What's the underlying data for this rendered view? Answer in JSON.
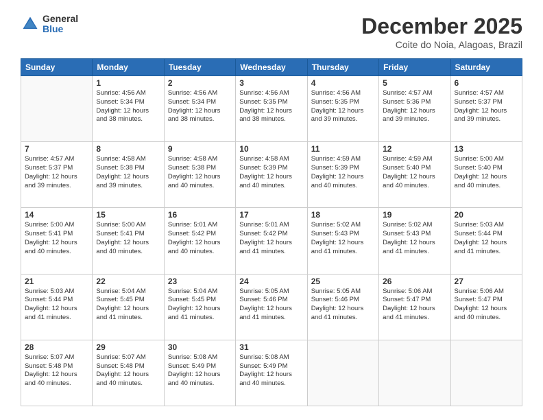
{
  "logo": {
    "general": "General",
    "blue": "Blue"
  },
  "title": "December 2025",
  "location": "Coite do Noia, Alagoas, Brazil",
  "days_of_week": [
    "Sunday",
    "Monday",
    "Tuesday",
    "Wednesday",
    "Thursday",
    "Friday",
    "Saturday"
  ],
  "weeks": [
    [
      {
        "day": "",
        "info": ""
      },
      {
        "day": "1",
        "info": "Sunrise: 4:56 AM\nSunset: 5:34 PM\nDaylight: 12 hours\nand 38 minutes."
      },
      {
        "day": "2",
        "info": "Sunrise: 4:56 AM\nSunset: 5:34 PM\nDaylight: 12 hours\nand 38 minutes."
      },
      {
        "day": "3",
        "info": "Sunrise: 4:56 AM\nSunset: 5:35 PM\nDaylight: 12 hours\nand 38 minutes."
      },
      {
        "day": "4",
        "info": "Sunrise: 4:56 AM\nSunset: 5:35 PM\nDaylight: 12 hours\nand 39 minutes."
      },
      {
        "day": "5",
        "info": "Sunrise: 4:57 AM\nSunset: 5:36 PM\nDaylight: 12 hours\nand 39 minutes."
      },
      {
        "day": "6",
        "info": "Sunrise: 4:57 AM\nSunset: 5:37 PM\nDaylight: 12 hours\nand 39 minutes."
      }
    ],
    [
      {
        "day": "7",
        "info": "Sunrise: 4:57 AM\nSunset: 5:37 PM\nDaylight: 12 hours\nand 39 minutes."
      },
      {
        "day": "8",
        "info": "Sunrise: 4:58 AM\nSunset: 5:38 PM\nDaylight: 12 hours\nand 39 minutes."
      },
      {
        "day": "9",
        "info": "Sunrise: 4:58 AM\nSunset: 5:38 PM\nDaylight: 12 hours\nand 40 minutes."
      },
      {
        "day": "10",
        "info": "Sunrise: 4:58 AM\nSunset: 5:39 PM\nDaylight: 12 hours\nand 40 minutes."
      },
      {
        "day": "11",
        "info": "Sunrise: 4:59 AM\nSunset: 5:39 PM\nDaylight: 12 hours\nand 40 minutes."
      },
      {
        "day": "12",
        "info": "Sunrise: 4:59 AM\nSunset: 5:40 PM\nDaylight: 12 hours\nand 40 minutes."
      },
      {
        "day": "13",
        "info": "Sunrise: 5:00 AM\nSunset: 5:40 PM\nDaylight: 12 hours\nand 40 minutes."
      }
    ],
    [
      {
        "day": "14",
        "info": "Sunrise: 5:00 AM\nSunset: 5:41 PM\nDaylight: 12 hours\nand 40 minutes."
      },
      {
        "day": "15",
        "info": "Sunrise: 5:00 AM\nSunset: 5:41 PM\nDaylight: 12 hours\nand 40 minutes."
      },
      {
        "day": "16",
        "info": "Sunrise: 5:01 AM\nSunset: 5:42 PM\nDaylight: 12 hours\nand 40 minutes."
      },
      {
        "day": "17",
        "info": "Sunrise: 5:01 AM\nSunset: 5:42 PM\nDaylight: 12 hours\nand 41 minutes."
      },
      {
        "day": "18",
        "info": "Sunrise: 5:02 AM\nSunset: 5:43 PM\nDaylight: 12 hours\nand 41 minutes."
      },
      {
        "day": "19",
        "info": "Sunrise: 5:02 AM\nSunset: 5:43 PM\nDaylight: 12 hours\nand 41 minutes."
      },
      {
        "day": "20",
        "info": "Sunrise: 5:03 AM\nSunset: 5:44 PM\nDaylight: 12 hours\nand 41 minutes."
      }
    ],
    [
      {
        "day": "21",
        "info": "Sunrise: 5:03 AM\nSunset: 5:44 PM\nDaylight: 12 hours\nand 41 minutes."
      },
      {
        "day": "22",
        "info": "Sunrise: 5:04 AM\nSunset: 5:45 PM\nDaylight: 12 hours\nand 41 minutes."
      },
      {
        "day": "23",
        "info": "Sunrise: 5:04 AM\nSunset: 5:45 PM\nDaylight: 12 hours\nand 41 minutes."
      },
      {
        "day": "24",
        "info": "Sunrise: 5:05 AM\nSunset: 5:46 PM\nDaylight: 12 hours\nand 41 minutes."
      },
      {
        "day": "25",
        "info": "Sunrise: 5:05 AM\nSunset: 5:46 PM\nDaylight: 12 hours\nand 41 minutes."
      },
      {
        "day": "26",
        "info": "Sunrise: 5:06 AM\nSunset: 5:47 PM\nDaylight: 12 hours\nand 41 minutes."
      },
      {
        "day": "27",
        "info": "Sunrise: 5:06 AM\nSunset: 5:47 PM\nDaylight: 12 hours\nand 40 minutes."
      }
    ],
    [
      {
        "day": "28",
        "info": "Sunrise: 5:07 AM\nSunset: 5:48 PM\nDaylight: 12 hours\nand 40 minutes."
      },
      {
        "day": "29",
        "info": "Sunrise: 5:07 AM\nSunset: 5:48 PM\nDaylight: 12 hours\nand 40 minutes."
      },
      {
        "day": "30",
        "info": "Sunrise: 5:08 AM\nSunset: 5:49 PM\nDaylight: 12 hours\nand 40 minutes."
      },
      {
        "day": "31",
        "info": "Sunrise: 5:08 AM\nSunset: 5:49 PM\nDaylight: 12 hours\nand 40 minutes."
      },
      {
        "day": "",
        "info": ""
      },
      {
        "day": "",
        "info": ""
      },
      {
        "day": "",
        "info": ""
      }
    ]
  ]
}
